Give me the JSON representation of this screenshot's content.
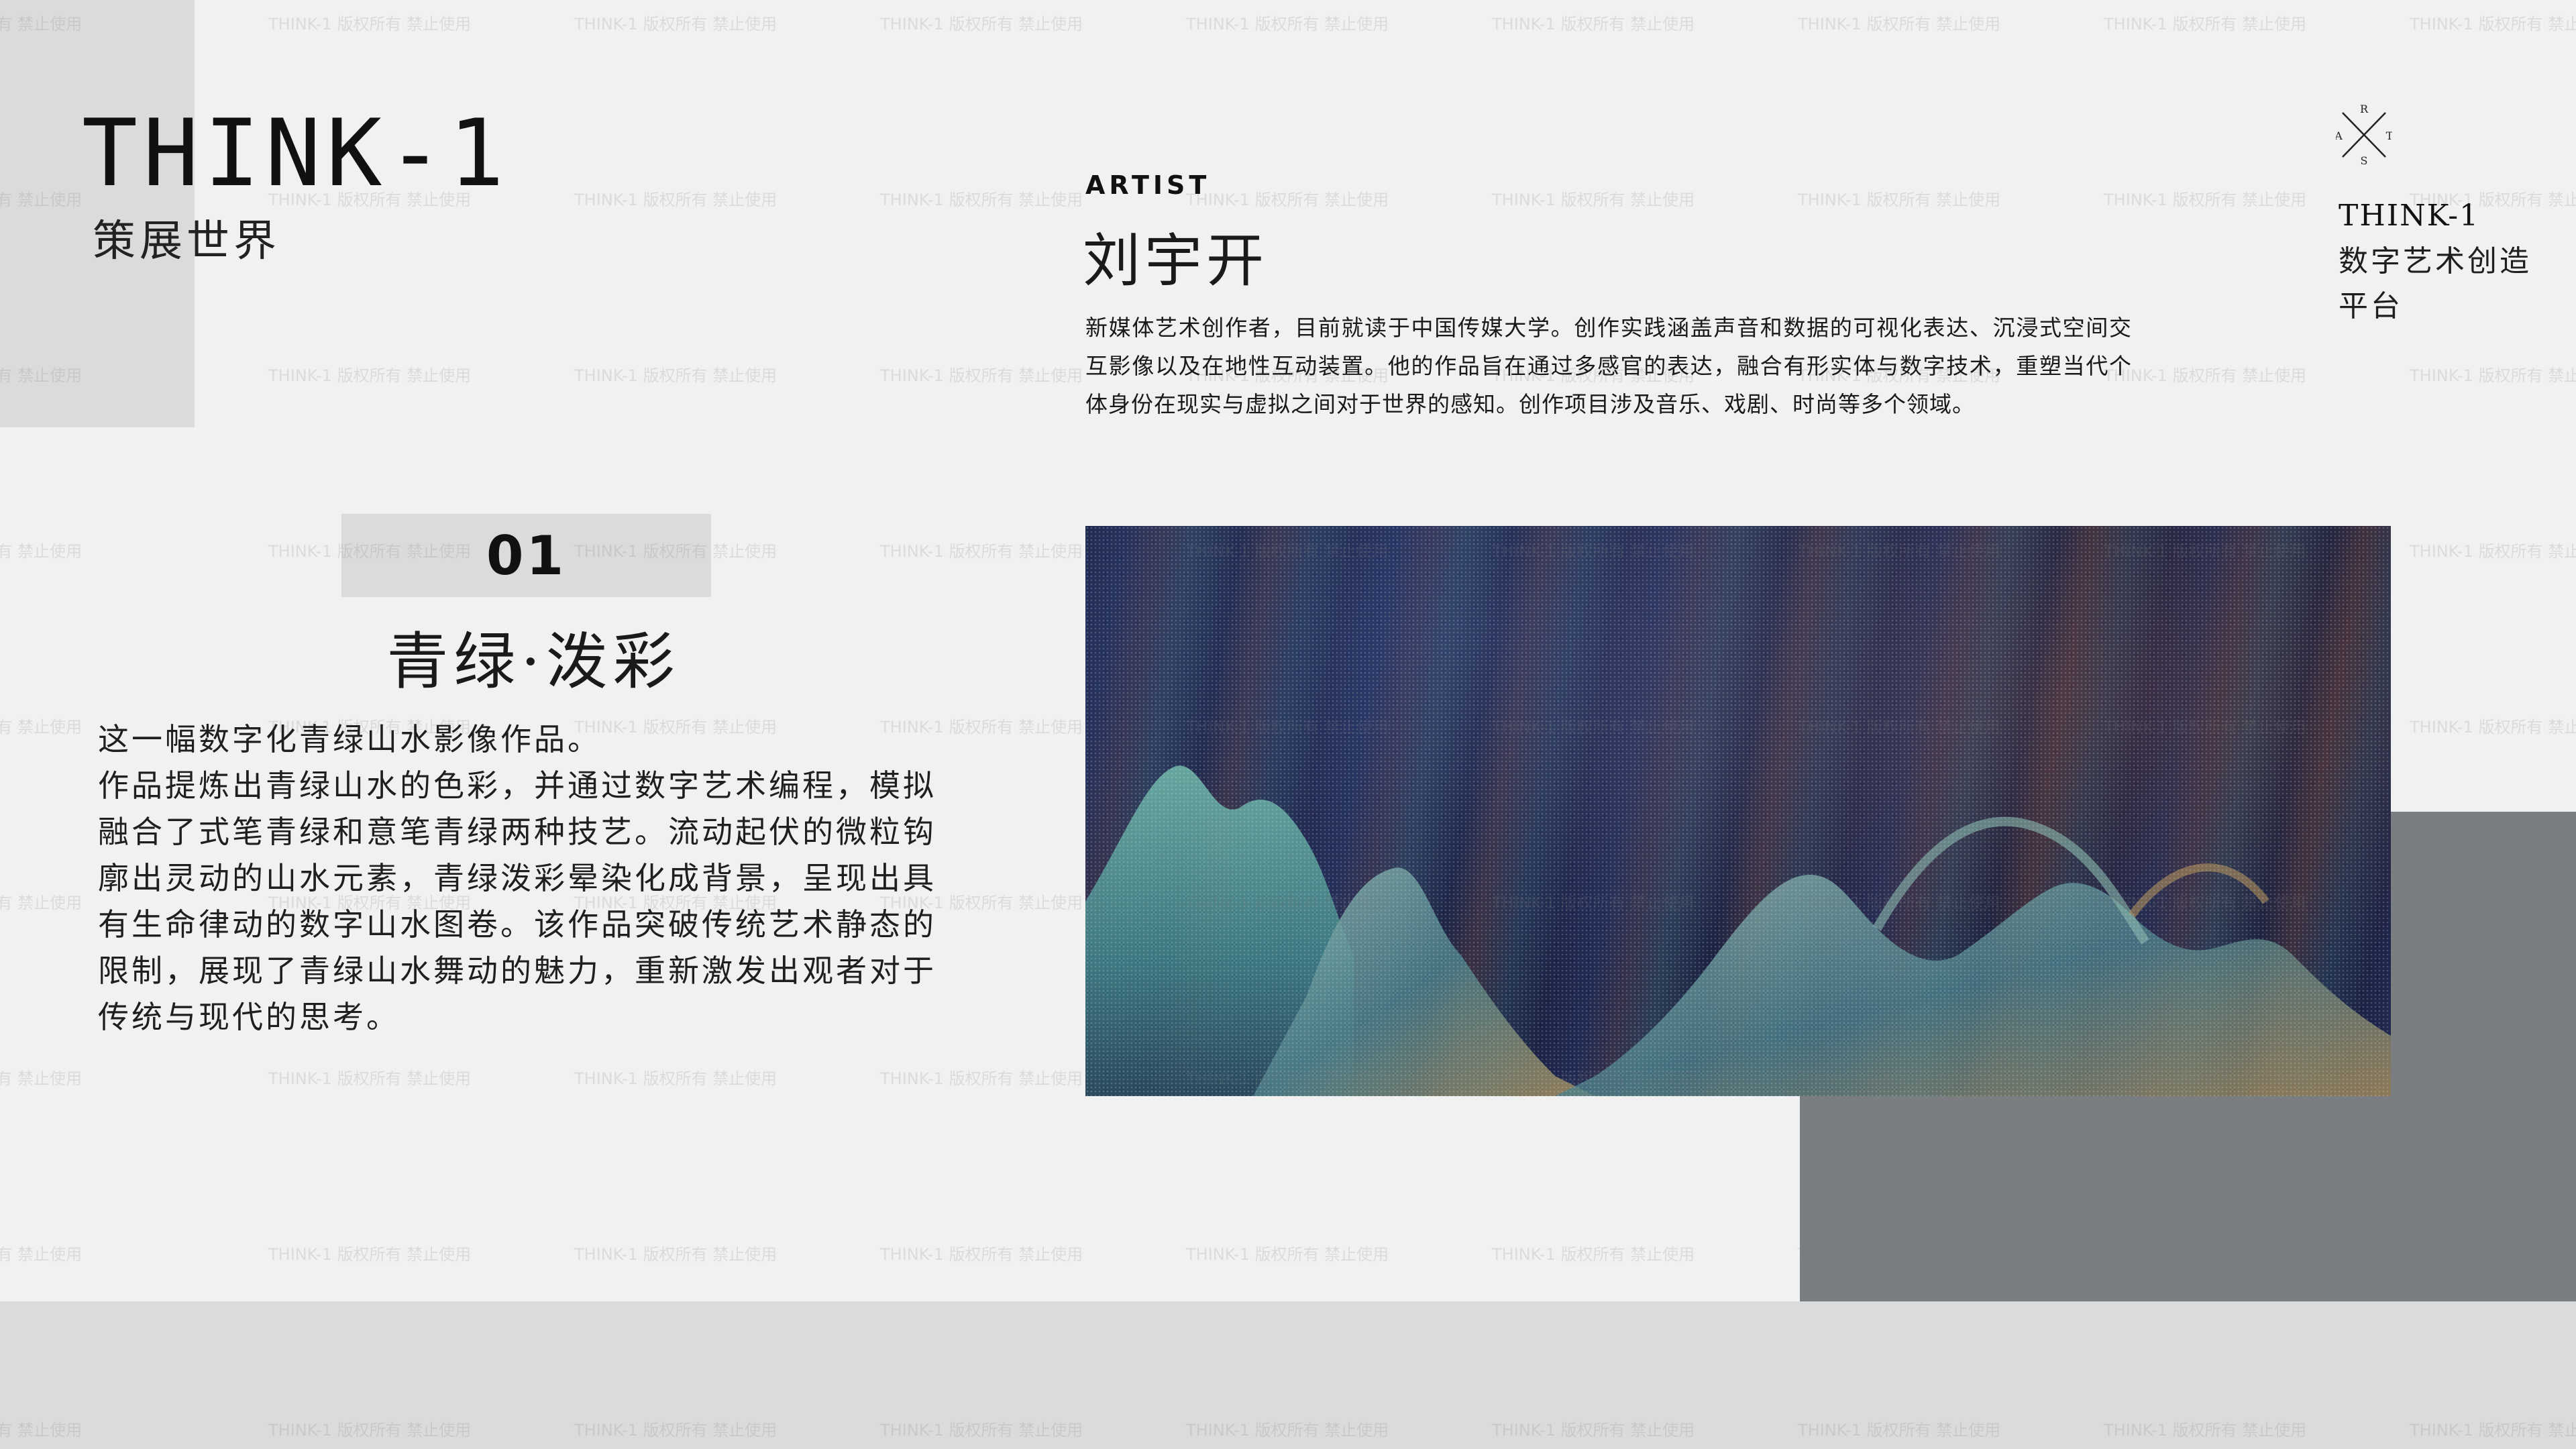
{
  "brand": {
    "title": "THINK-1",
    "subtitle": "策展世界"
  },
  "logo": {
    "icon": "arts-cross-icon",
    "letters": [
      "R",
      "A",
      "T",
      "S"
    ]
  },
  "platform": {
    "name": "THINK-1",
    "desc": "数字艺术创造平台"
  },
  "work": {
    "number": "01",
    "title": "青绿·泼彩",
    "intro": "这一幅数字化青绿山水影像作品。",
    "body": "作品提炼出青绿山水的色彩，并通过数字艺术编程，模拟融合了式笔青绿和意笔青绿两种技艺。流动起伏的微粒钩廓出灵动的山水元素，青绿泼彩晕染化成背景，呈现出具有生命律动的数字山水图卷。该作品突破传统艺术静态的限制，展现了青绿山水舞动的魅力，重新激发出观者对于传统与现代的思考。"
  },
  "artist": {
    "label": "ARTIST",
    "name": "刘宇开",
    "bio": "新媒体艺术创作者，目前就读于中国传媒大学。创作实践涵盖声音和数据的可视化表达、沉浸式空间交互影像以及在地性互动装置。他的作品旨在通过多感官的表达，融合有形实体与数字技术，重塑当代个体身份在现实与虚拟之间对于世界的感知。创作项目涉及音乐、戏剧、时尚等多个领域。"
  },
  "watermark": {
    "text": "THINK-1 版权所有 禁止使用"
  },
  "colors": {
    "page_bg": "#f1f1f1",
    "light_block": "#d9dbdc",
    "dark_block": "#7b7e80",
    "text": "#1a1a1a"
  }
}
